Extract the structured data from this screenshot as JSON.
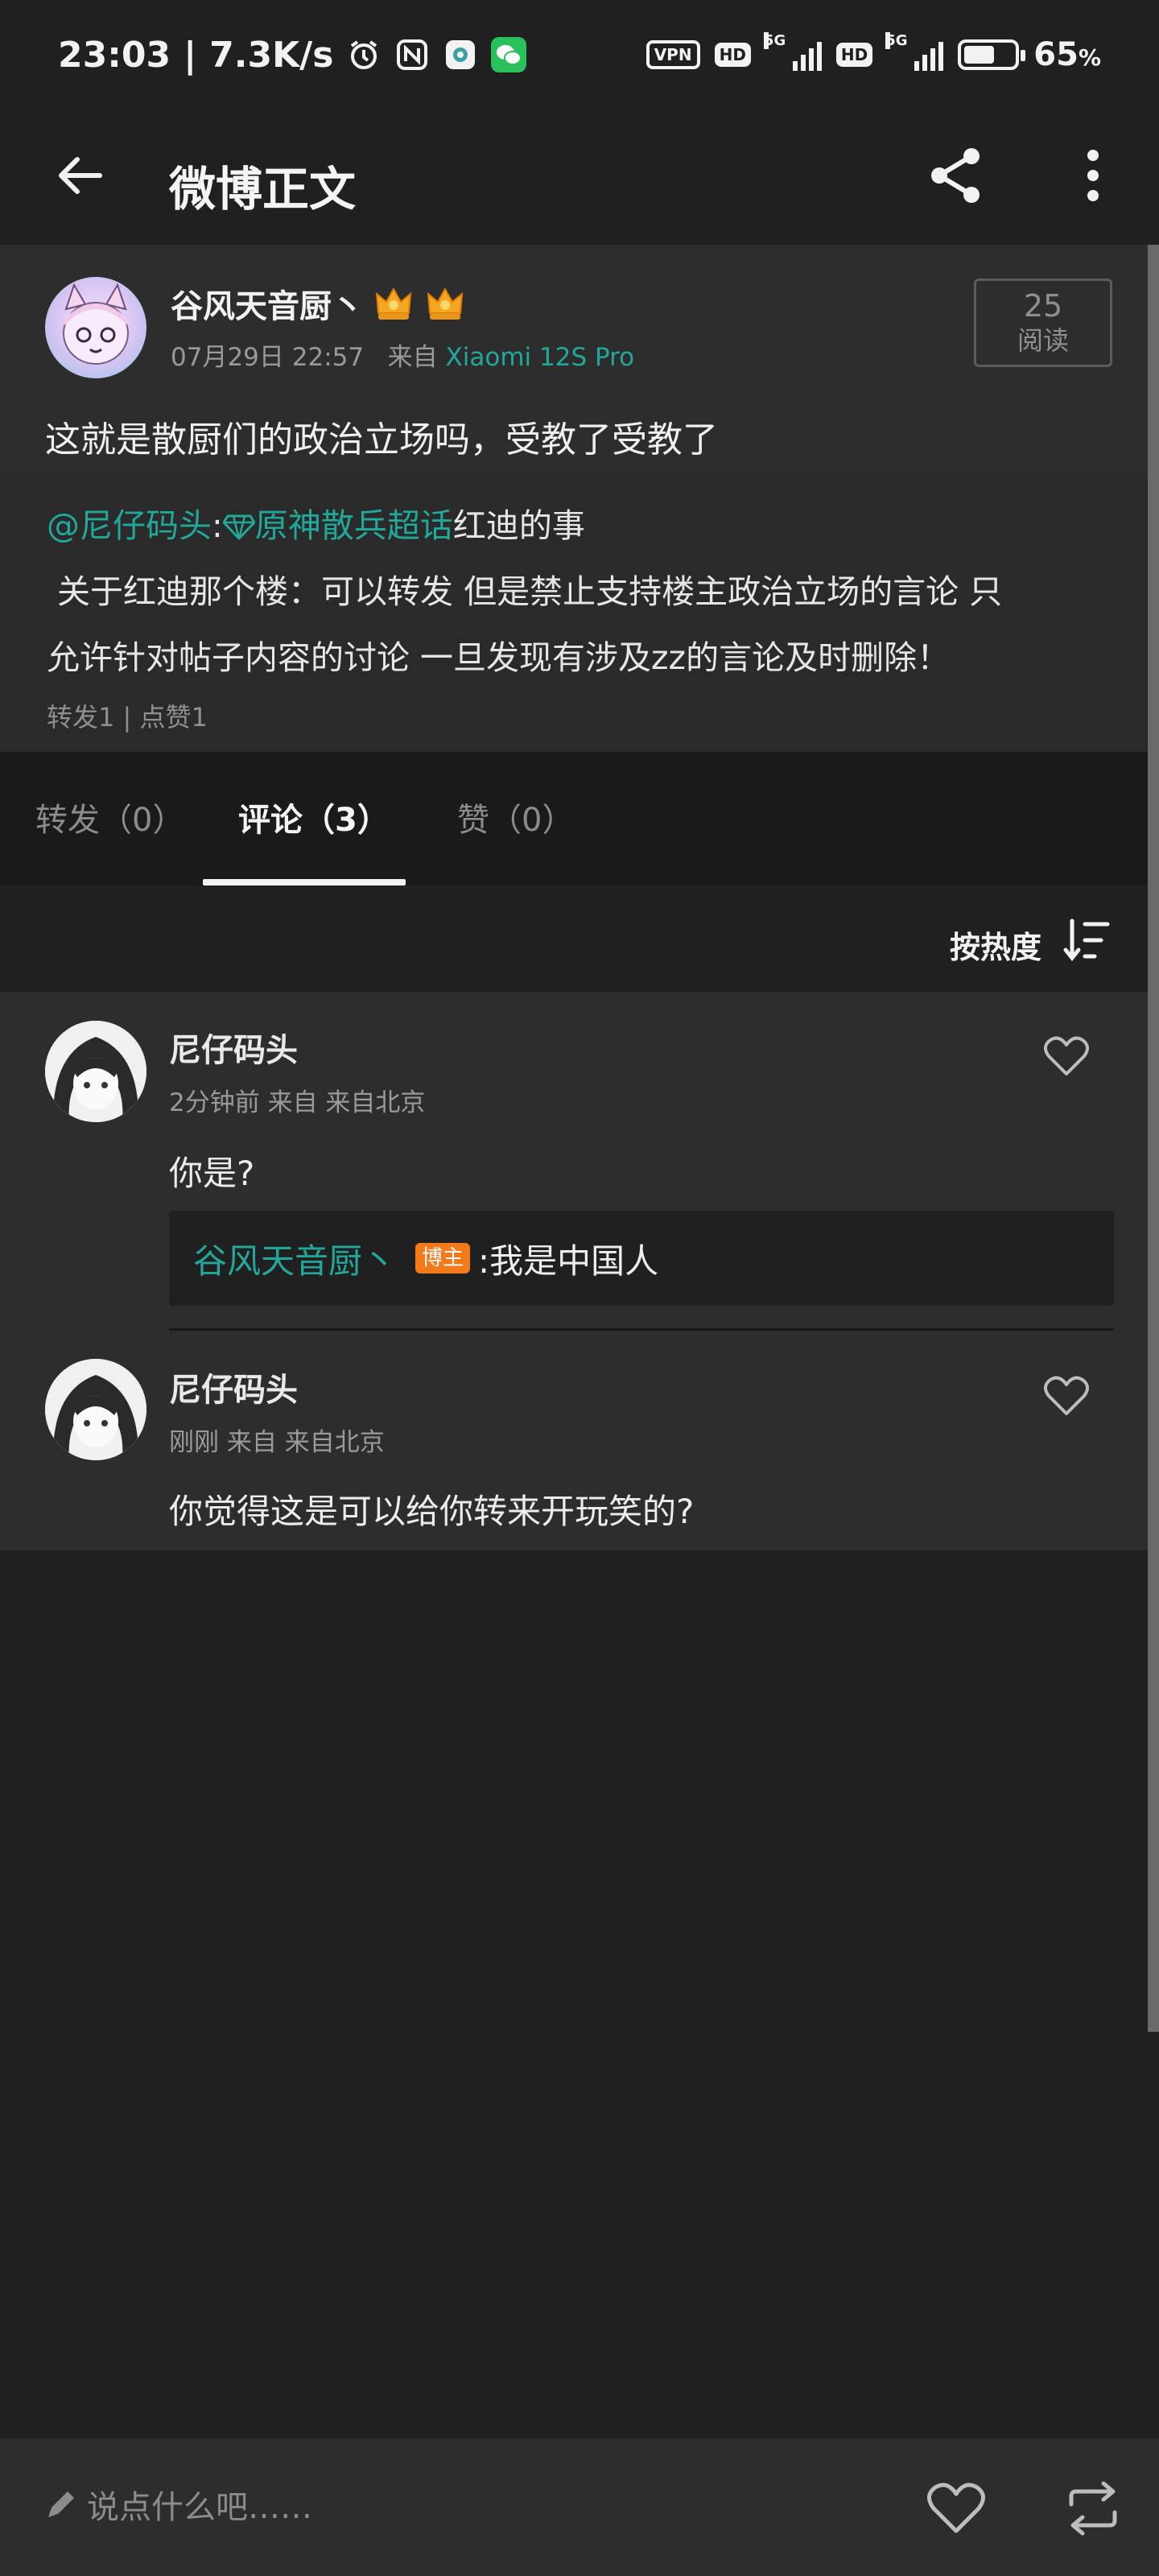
{
  "status_bar": {
    "time": "23:03",
    "separator": "|",
    "net_speed": "7.3K/s",
    "vpn": "VPN",
    "hd1": "HD",
    "hd2": "HD",
    "net1": "5G",
    "net2": "5G",
    "battery": "65",
    "battery_unit": "%"
  },
  "header": {
    "title": "微博正文",
    "icons": {
      "back": "arrow-left-icon",
      "share": "share-icon",
      "more": "more-vertical-icon"
    }
  },
  "post": {
    "author": "谷风天音厨丶",
    "date": "07月29日 22:57",
    "source_prefix": "来自",
    "device": "Xiaomi 12S Pro",
    "read_count": "25",
    "read_label": "阅读",
    "text": "这就是散厨们的政治立场吗，受教了受教了"
  },
  "repost": {
    "mention": "@尼仔码头",
    "colon": ":",
    "topic": "原神散兵超话",
    "title_rest": "红迪的事",
    "line2": " 关于红迪那个楼：可以转发 但是禁止支持楼主政治立场的言论 只",
    "line3": "允许针对帖子内容的讨论 一旦发现有涉及zz的言论及时删除！",
    "stats": "转发1 | 点赞1"
  },
  "tabs": [
    {
      "label": "转发（0）"
    },
    {
      "label": "评论（3）"
    },
    {
      "label": "赞（0）"
    }
  ],
  "sort": {
    "label": "按热度"
  },
  "comments": [
    {
      "name": "尼仔码头",
      "meta": "2分钟前 来自 来自北京",
      "text": "你是?",
      "reply": {
        "name": "谷风天音厨丶",
        "badge": "博主",
        "text": ":我是中国人"
      }
    },
    {
      "name": "尼仔码头",
      "meta": "刚刚 来自 来自北京",
      "text": "你觉得这是可以给你转来开玩笑的?"
    }
  ],
  "bottom_bar": {
    "placeholder": "说点什么吧……"
  },
  "colors": {
    "accent": "#22a89a",
    "badge": "#f27a1a",
    "background": "#202020",
    "card": "#2d2d2d"
  }
}
